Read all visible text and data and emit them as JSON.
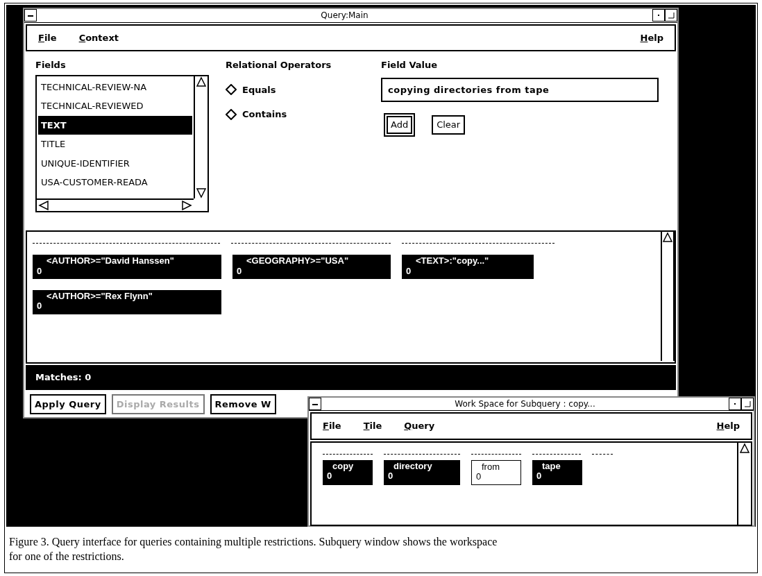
{
  "main_window": {
    "title": "Query:Main",
    "menu": [
      {
        "label": "File"
      },
      {
        "label": "Context"
      },
      {
        "label": "Help"
      }
    ],
    "fields": {
      "label": "Fields",
      "items": [
        {
          "label": "TECHNICAL-REVIEW-NA",
          "selected": false
        },
        {
          "label": "TECHNICAL-REVIEWED",
          "selected": false
        },
        {
          "label": "TEXT",
          "selected": true
        },
        {
          "label": "TITLE",
          "selected": false
        },
        {
          "label": "UNIQUE-IDENTIFIER",
          "selected": false
        },
        {
          "label": "USA-CUSTOMER-READA",
          "selected": false
        }
      ]
    },
    "operators": {
      "label": "Relational Operators",
      "options": [
        {
          "label": "Equals",
          "selected": false
        },
        {
          "label": "Contains",
          "selected": false
        }
      ]
    },
    "field_value": {
      "label": "Field Value",
      "value": "copying directories from tape"
    },
    "value_buttons": [
      {
        "label": "Add",
        "default": true
      },
      {
        "label": "Clear",
        "default": false
      }
    ],
    "restrictions": [
      {
        "label": "<AUTHOR>=\"David Hanssen\"",
        "count": "0",
        "highlighted": true
      },
      {
        "label": "<GEOGRAPHY>=\"USA\"",
        "count": "0",
        "highlighted": true
      },
      {
        "label": "<TEXT>:\"copy...\"",
        "count": "0",
        "highlighted": true
      },
      {
        "label": "<AUTHOR>=\"Rex Flynn\"",
        "count": "0",
        "highlighted": true
      }
    ],
    "matches": "Matches: 0",
    "buttons": [
      {
        "label": "Apply Query",
        "disabled": false
      },
      {
        "label": "Display Results",
        "disabled": true
      },
      {
        "label": "Remove W",
        "disabled": false
      }
    ]
  },
  "subquery_window": {
    "title": "Work Space for Subquery : copy...",
    "menu": [
      {
        "label": "File"
      },
      {
        "label": "Tile"
      },
      {
        "label": "Query"
      },
      {
        "label": "Help"
      }
    ],
    "terms": [
      {
        "label": "copy",
        "count": "0",
        "highlighted": true
      },
      {
        "label": "directory",
        "count": "0",
        "highlighted": true
      },
      {
        "label": "from",
        "count": "0",
        "highlighted": false
      },
      {
        "label": "tape",
        "count": "0",
        "highlighted": true
      }
    ]
  },
  "caption": [
    "Figure 3.  Query interface for queries containing multiple restrictions.  Subquery window shows the workspace",
    "for one of the restrictions."
  ]
}
